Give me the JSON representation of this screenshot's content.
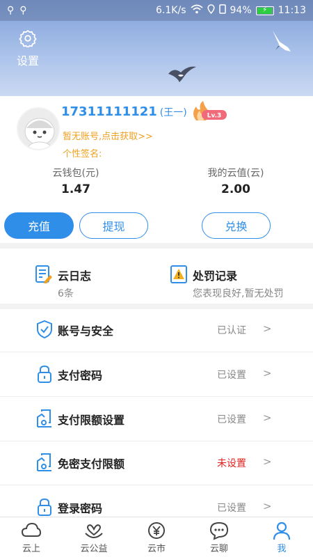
{
  "status_bar": {
    "speed": "6.1K/s",
    "battery": "94%",
    "time": "11:13"
  },
  "header": {
    "settings_label": "设置"
  },
  "profile": {
    "phone": "17311111121",
    "nickname": "(王一)",
    "level": "Lv.3",
    "account_link": "暂无账号,点击获取>>",
    "signature": "个性签名:"
  },
  "wallet": {
    "cloud_wallet_label": "云钱包(元)",
    "cloud_wallet_value": "1.47",
    "cloud_value_label": "我的云值(云)",
    "cloud_value_value": "2.00"
  },
  "actions": {
    "recharge": "充值",
    "withdraw": "提现",
    "exchange": "兑换"
  },
  "cards": {
    "diary_title": "云日志",
    "diary_count": "6条",
    "penalty_title": "处罚记录",
    "penalty_desc": "您表现良好,暂无处罚"
  },
  "list": [
    {
      "label": "账号与安全",
      "status": "已认证",
      "arrow": ">"
    },
    {
      "label": "支付密码",
      "status": "已设置",
      "arrow": ">"
    },
    {
      "label": "支付限额设置",
      "status": "已设置",
      "arrow": ">"
    },
    {
      "label": "免密支付限额",
      "status": "未设置",
      "arrow": ">"
    },
    {
      "label": "登录密码",
      "status": "已设置",
      "arrow": ">"
    }
  ],
  "bottom_nav": [
    {
      "label": "云上",
      "icon": "cloud-icon"
    },
    {
      "label": "云公益",
      "icon": "charity-heart-icon"
    },
    {
      "label": "云市",
      "icon": "yuan-market-icon"
    },
    {
      "label": "云聊",
      "icon": "chat-icon"
    },
    {
      "label": "我",
      "icon": "user-icon"
    }
  ],
  "colors": {
    "accent": "#2f8ee8",
    "warning": "#f0a020",
    "unset_red": "#e02020"
  }
}
